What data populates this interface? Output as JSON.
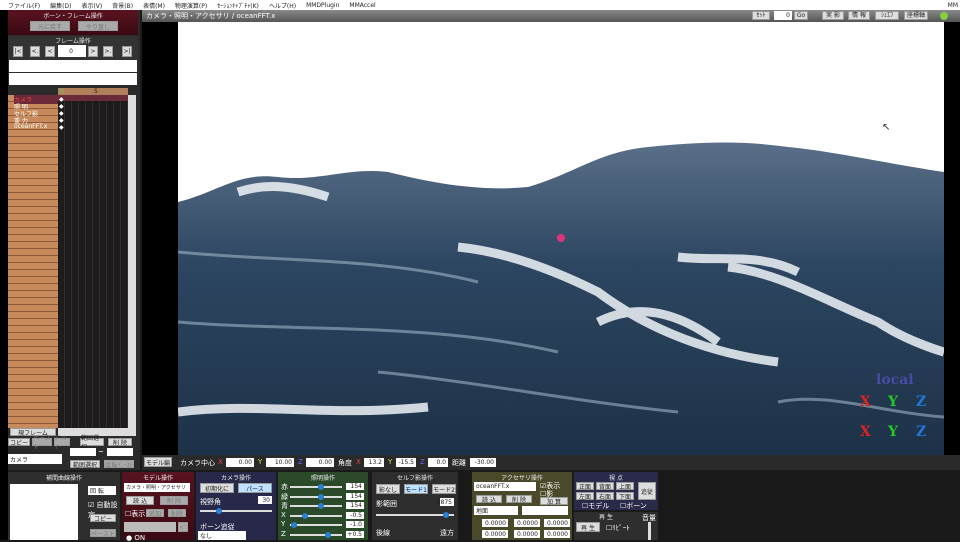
{
  "menu": [
    "ファイル(F)",
    "編集(D)",
    "表示(V)",
    "背景(B)",
    "表情(M)",
    "物理演算(P)",
    "ｾｰｼｮﾝｷｬﾌﾟﾁｬ(K)",
    "ヘルプ(H)",
    "MMDPlugin",
    "MMAccel"
  ],
  "menu_right": "MM",
  "bone_frame": {
    "title": "ボーン・フレーム操作",
    "btn_restore": "元に戻す",
    "btn_redo": "やり直し"
  },
  "frame_ops": {
    "title": "フレーム操作",
    "frame": "0",
    "nav": [
      "|<",
      "<.",
      "<",
      ">",
      ">.",
      ">|"
    ]
  },
  "timeline": {
    "col0": "0",
    "col5": "5",
    "rows": [
      "カメラ",
      "照 明",
      "セルフ影",
      "重 力",
      "oceanFFT.x"
    ],
    "current_frame_btn": "現フレーム",
    "copy": "コピー",
    "paste": "ペースト",
    "del": "ﾃﾞｨﾚｲ",
    "range_sel": "範囲選択",
    "delete": "削 除",
    "mode": "カメラ",
    "tilde": "~",
    "range_select": "範囲選択",
    "reverse": "反転ﾍﾟｰｽﾄ"
  },
  "viewport": {
    "title": "カメラ・照明・アクセサリ / oceanFFT.x",
    "set_label": "ｾｯﾄ",
    "set_value": "0",
    "go": "Go",
    "btn_real": "実 影",
    "btn_info": "情 報",
    "btn_local": "ｼｪｴﾌ",
    "btn_coord": "座標軸",
    "local_label": "local",
    "axes": [
      "X",
      "Y",
      "Z"
    ]
  },
  "coordbar": {
    "model_btn": "モデル編",
    "cam_center": "カメラ中心",
    "x": "0.00",
    "y": "10.00",
    "z": "0.00",
    "angle": "角度",
    "ax": "13.2",
    "ay": "-15.5",
    "az": "0.0",
    "dist_label": "距離",
    "dist": "-30.00"
  },
  "interp": {
    "title": "補間曲線操作",
    "rotate": "回 転",
    "auto": "自動設定",
    "copy": "コピー",
    "paste": "ペースト"
  },
  "model_ops": {
    "title": "モデル操作",
    "model": "カメラ・照明・アクセサリ",
    "load": "読 込",
    "delete": "削 除",
    "show": "表示",
    "add": "追加",
    "del": "削除",
    "hat": "ﾍﾞ",
    "on": "ON"
  },
  "camera_ops": {
    "title": "カメラ操作",
    "reset": "初期化に",
    "perspective": "パース",
    "fov_label": "視野角",
    "fov": "30",
    "follow": "ボーン追従",
    "follow_val": "なし"
  },
  "light_ops": {
    "title": "照明操作",
    "labels": [
      "赤",
      "緑",
      "青",
      "X",
      "Y",
      "Z"
    ],
    "values": [
      "154",
      "154",
      "154",
      "-0.5",
      "-1.0",
      "+0.5"
    ],
    "fractions": [
      0.6,
      0.6,
      0.6,
      0.25,
      0.02,
      0.75
    ]
  },
  "self_shadow": {
    "title": "セルフ影操作",
    "none": "影なし",
    "mode1": "モード1",
    "mode2": "モード2",
    "dist_label": "影範囲",
    "dist": "8875",
    "near": "後線",
    "far": "遠方",
    "fraction": 0.93
  },
  "accessory": {
    "title": "アクセサリ操作",
    "name": "oceanFFT.x",
    "show": "表示",
    "shadow": "影",
    "load": "読 込",
    "delete": "削 除",
    "add": "加 算",
    "parent": "地面",
    "x": "0.0000",
    "y": "0.0000",
    "z": "0.0000",
    "rx": "0.0000",
    "ry": "0.0000",
    "rz": "0.0000"
  },
  "viewpoint": {
    "title": "視 点",
    "front": "正面",
    "back": "背面",
    "top": "上面",
    "left": "左面",
    "right": "右面",
    "bottom": "下面",
    "track": "追従",
    "model": "モデル",
    "bone": "ボーン"
  },
  "play": {
    "title": "再 生",
    "play": "再 生",
    "loop": "ﾘﾋﾟｰﾄ",
    "volume": "音量"
  }
}
